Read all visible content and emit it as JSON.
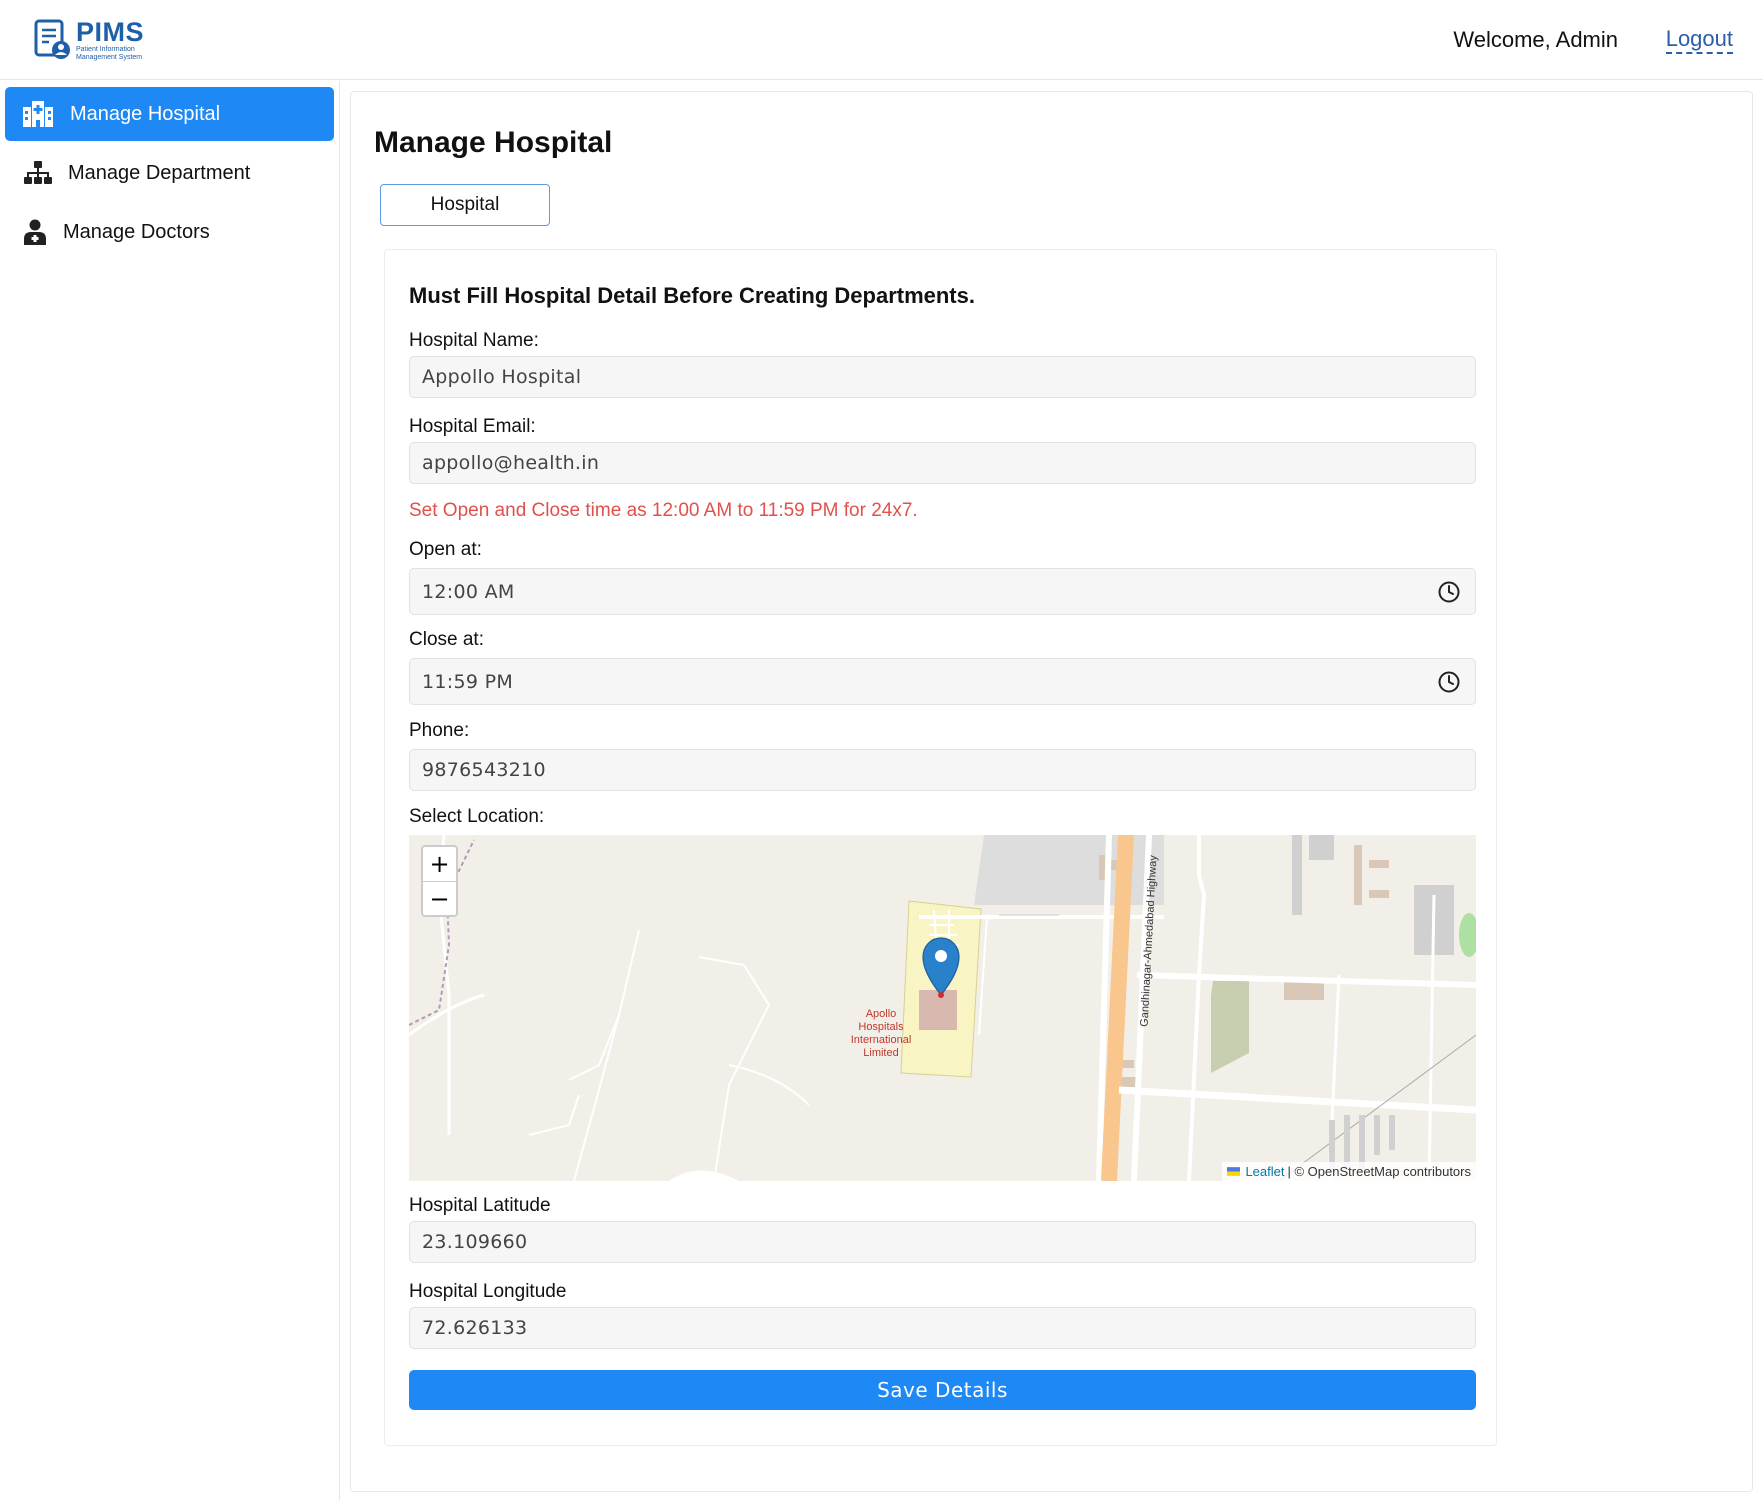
{
  "header": {
    "logo_title": "PIMS",
    "logo_subtitle_1": "Patient Information",
    "logo_subtitle_2": "Management System",
    "welcome_text": "Welcome, Admin",
    "logout_label": "Logout"
  },
  "sidebar": {
    "items": [
      {
        "label": "Manage Hospital",
        "icon": "hospital-icon",
        "active": true
      },
      {
        "label": "Manage Department",
        "icon": "org-chart-icon",
        "active": false
      },
      {
        "label": "Manage Doctors",
        "icon": "doctor-icon",
        "active": false
      }
    ]
  },
  "main": {
    "title": "Manage Hospital",
    "tab_label": "Hospital",
    "form": {
      "heading": "Must Fill Hospital Detail Before Creating Departments.",
      "hospital_name_label": "Hospital Name:",
      "hospital_name_value": "Appollo Hospital",
      "hospital_email_label": "Hospital Email:",
      "hospital_email_value": "appollo@health.in",
      "time_note": "Set Open and Close time as 12:00 AM to 11:59 PM for 24x7.",
      "open_label": "Open at:",
      "open_value": "12:00 AM",
      "close_label": "Close at:",
      "close_value": "11:59 PM",
      "phone_label": "Phone:",
      "phone_value": "9876543210",
      "location_label": "Select Location:",
      "latitude_label": "Hospital Latitude",
      "latitude_value": "23.109660",
      "longitude_label": "Hospital Longitude",
      "longitude_value": "72.626133",
      "save_label": "Save Details"
    },
    "map": {
      "zoom_in": "+",
      "zoom_out": "−",
      "marker_label_1": "Apollo",
      "marker_label_2": "Hospitals",
      "marker_label_3": "International",
      "marker_label_4": "Limited",
      "road_label": "Gandhinagar-Ahmedabad Highway",
      "attribution_leaflet": "Leaflet",
      "attribution_rest": "| © OpenStreetMap contributors"
    }
  },
  "colors": {
    "accent": "#1e88f5",
    "brand": "#1f5fa8",
    "warning_text": "#e0504d"
  }
}
